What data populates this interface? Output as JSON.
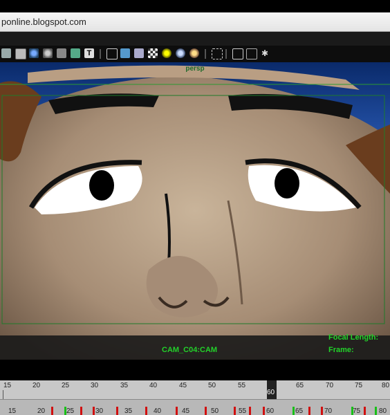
{
  "browser": {
    "url_fragment": "ponline.blogspot.com"
  },
  "toolbar": {
    "icons": [
      "layer-icon",
      "grid-icon",
      "sphere-icon",
      "sphere-solid-icon",
      "xray-icon",
      "uv-icon",
      "text-icon",
      "cube-wire-icon",
      "cube-icon",
      "cube-outline-icon",
      "checker-icon",
      "light-yellow-icon",
      "light-blue-icon",
      "light-gold-icon",
      "select-icon",
      "cube-small-icon",
      "copy-icon",
      "share-icon"
    ]
  },
  "viewport": {
    "label": "persp",
    "camera_name": "CAM_C04:CAM",
    "focal_length_label": "Focal Length:",
    "frame_label": "Frame:"
  },
  "timeline": {
    "numbers": [
      "15",
      "20",
      "25",
      "30",
      "35",
      "40",
      "45",
      "50",
      "55",
      "60",
      "65",
      "70",
      "75",
      "80"
    ],
    "current_frame": "60",
    "lower_numbers": [
      "15",
      "20",
      "25",
      "30",
      "35",
      "40",
      "45",
      "50",
      "55",
      "60",
      "65",
      "70",
      "75",
      "80"
    ]
  },
  "colors": {
    "hud_green": "#22d22a",
    "keyframe_red": "#d01010",
    "keyframe_green": "#18c018"
  }
}
